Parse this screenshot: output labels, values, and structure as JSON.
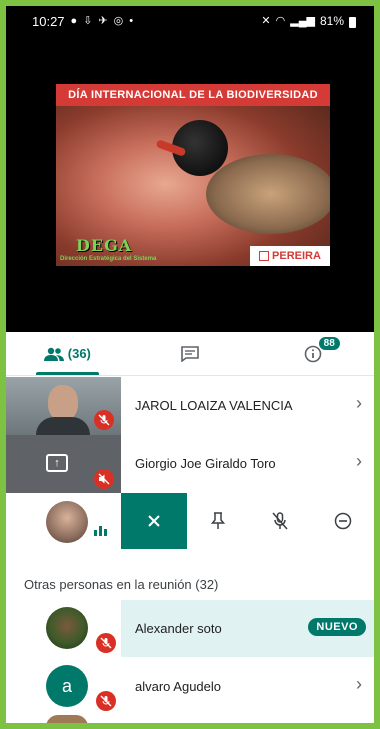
{
  "status_bar": {
    "time": "10:27",
    "battery": "81%"
  },
  "video": {
    "poster_title": "DÍA INTERNACIONAL DE LA BIODIVERSIDAD",
    "logo_left": "DEGA",
    "logo_left_sub": "Dirección Estratégica del Sistema",
    "logo_right": "PEREIRA"
  },
  "tabs": {
    "people_count": "(36)",
    "chat_badge": "88"
  },
  "participants": [
    {
      "name": "JAROL LOAIZA VALENCIA"
    },
    {
      "name": "Giorgio Joe Giraldo Toro"
    }
  ],
  "others_section": {
    "label": "Otras personas en la reunión (32)"
  },
  "others": [
    {
      "name": "Alexander soto",
      "badge": "NUEVO"
    },
    {
      "name": "alvaro Agudelo",
      "initial": "a"
    }
  ],
  "colors": {
    "accent": "#00796b",
    "mute": "#d93025",
    "highlight": "#e0f2f1",
    "frame": "#7dc242"
  }
}
